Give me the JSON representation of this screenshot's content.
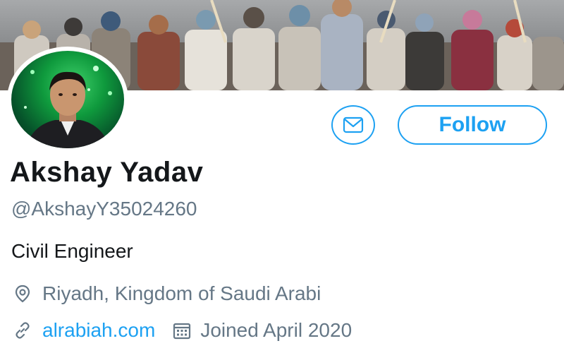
{
  "profile": {
    "name": "Akshay Yadav",
    "handle": "@AkshayY35024260",
    "bio": "Civil Engineer",
    "location": "Riyadh, Kingdom of Saudi Arabi",
    "website": "alrabiah.com",
    "joined": "Joined April 2020"
  },
  "actions": {
    "follow_label": "Follow",
    "message_icon": "mail-icon"
  },
  "icons": {
    "location": "location-pin-icon",
    "link": "link-icon",
    "calendar": "calendar-icon"
  },
  "colors": {
    "accent": "#1da1f2",
    "text_primary": "#14171a",
    "text_secondary": "#657786"
  }
}
